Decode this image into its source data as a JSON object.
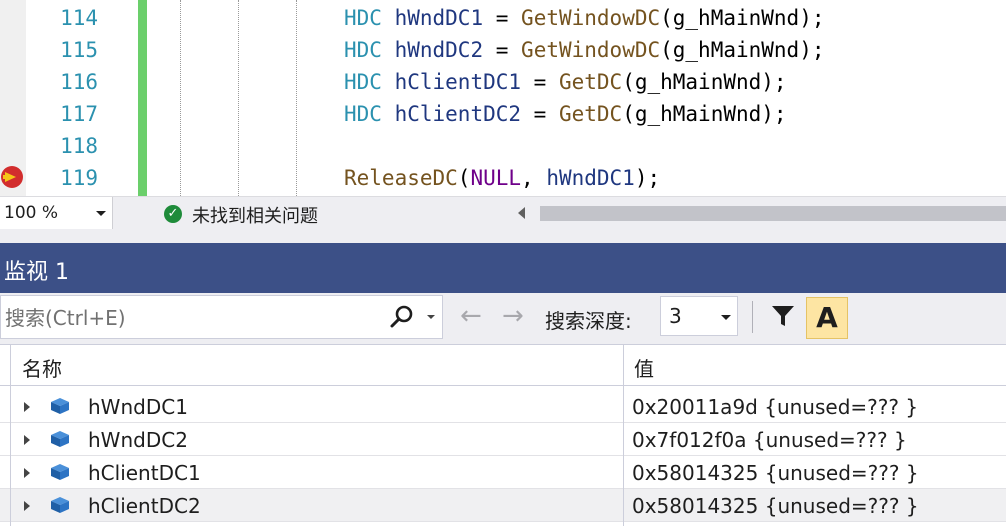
{
  "editor": {
    "lines": [
      {
        "num": "114",
        "tokens": [
          {
            "t": "HDC",
            "c": "type"
          },
          {
            "t": " ",
            "c": "plain"
          },
          {
            "t": "hWndDC1",
            "c": "var"
          },
          {
            "t": " = ",
            "c": "plain"
          },
          {
            "t": "GetWindowDC",
            "c": "func"
          },
          {
            "t": "(g_hMainWnd);",
            "c": "plain"
          }
        ]
      },
      {
        "num": "115",
        "tokens": [
          {
            "t": "HDC",
            "c": "type"
          },
          {
            "t": " ",
            "c": "plain"
          },
          {
            "t": "hWndDC2",
            "c": "var"
          },
          {
            "t": " = ",
            "c": "plain"
          },
          {
            "t": "GetWindowDC",
            "c": "func"
          },
          {
            "t": "(g_hMainWnd);",
            "c": "plain"
          }
        ]
      },
      {
        "num": "116",
        "tokens": [
          {
            "t": "HDC",
            "c": "type"
          },
          {
            "t": " ",
            "c": "plain"
          },
          {
            "t": "hClientDC1",
            "c": "var"
          },
          {
            "t": " = ",
            "c": "plain"
          },
          {
            "t": "GetDC",
            "c": "func"
          },
          {
            "t": "(g_hMainWnd);",
            "c": "plain"
          }
        ]
      },
      {
        "num": "117",
        "tokens": [
          {
            "t": "HDC",
            "c": "type"
          },
          {
            "t": " ",
            "c": "plain"
          },
          {
            "t": "hClientDC2",
            "c": "var"
          },
          {
            "t": " = ",
            "c": "plain"
          },
          {
            "t": "GetDC",
            "c": "func"
          },
          {
            "t": "(g_hMainWnd);",
            "c": "plain"
          }
        ]
      },
      {
        "num": "118",
        "tokens": []
      },
      {
        "num": "119",
        "tokens": [
          {
            "t": "ReleaseDC",
            "c": "func"
          },
          {
            "t": "(",
            "c": "plain"
          },
          {
            "t": "NULL",
            "c": "macro"
          },
          {
            "t": ", ",
            "c": "plain"
          },
          {
            "t": "hWndDC1",
            "c": "var"
          },
          {
            "t": ");",
            "c": "plain"
          }
        ]
      }
    ],
    "breakpoint_line_icon": "breakpoint-current-statement-icon"
  },
  "status": {
    "zoom": "100 %",
    "issues_text": "未找到相关问题",
    "issues_icon": "check-circle-icon"
  },
  "watch": {
    "title": "监视 1",
    "search_placeholder": "搜索(Ctrl+E)",
    "search_icon": "search-icon",
    "back_glyph": "←",
    "forward_glyph": "→",
    "depth_label": "搜索深度:",
    "depth_value": "3",
    "filter_icon": "filter-icon",
    "hex_label": "A",
    "columns": {
      "name": "名称",
      "value": "值"
    },
    "rows": [
      {
        "name": "hWndDC1",
        "value": "0x20011a9d {unused=??? }"
      },
      {
        "name": "hWndDC2",
        "value": "0x7f012f0a {unused=??? }"
      },
      {
        "name": "hClientDC1",
        "value": "0x58014325 {unused=??? }"
      },
      {
        "name": "hClientDC2",
        "value": "0x58014325 {unused=??? }"
      }
    ]
  },
  "colors": {
    "watch_title_bg": "#3c5087",
    "change_bar": "#6bcf6b",
    "type": "#2b91af",
    "function": "#74531f",
    "variable": "#1f377f",
    "macro": "#6f008a"
  }
}
